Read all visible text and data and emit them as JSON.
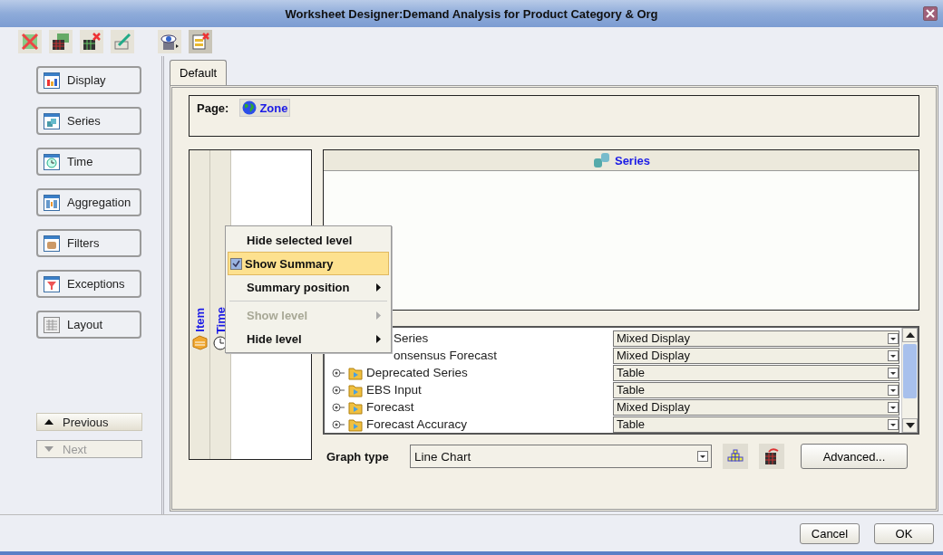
{
  "window": {
    "title": "Worksheet Designer:Demand Analysis for Product Category & Org"
  },
  "toolbar": [
    {
      "kind": "delete",
      "pressed": false
    },
    {
      "kind": "grid",
      "pressed": false
    },
    {
      "kind": "grid-delete",
      "pressed": false
    },
    {
      "kind": "edit",
      "pressed": false
    },
    {
      "kind": "view",
      "pressed": false
    },
    {
      "kind": "close-list",
      "pressed": true
    }
  ],
  "nav_buttons": [
    {
      "label": "Display",
      "kind": "display"
    },
    {
      "label": "Series",
      "kind": "series"
    },
    {
      "label": "Time",
      "kind": "time"
    },
    {
      "label": "Aggregation",
      "kind": "aggregation"
    },
    {
      "label": "Filters",
      "kind": "filters"
    },
    {
      "label": "Exceptions",
      "kind": "exceptions"
    },
    {
      "label": "Layout",
      "kind": "layout"
    }
  ],
  "step_buttons": [
    {
      "label": "Previous",
      "kind": "up",
      "disabled": false
    },
    {
      "label": "Next",
      "kind": "down",
      "disabled": true
    }
  ],
  "tabs": [
    {
      "label": "Default",
      "selected": true
    }
  ],
  "page": {
    "label": "Page:",
    "dimension": "Zone"
  },
  "axes": [
    {
      "label": "Item",
      "kind": "item"
    },
    {
      "label": "Time",
      "kind": "time"
    }
  ],
  "series_panel": {
    "title": "Series"
  },
  "context_menu": [
    {
      "kind": "item",
      "label": "Hide selected level",
      "checked": false,
      "selected": false,
      "disabled": false,
      "submenu": false
    },
    {
      "kind": "item",
      "label": "Show Summary",
      "checked": true,
      "selected": true,
      "disabled": false,
      "submenu": false
    },
    {
      "kind": "item",
      "label": "Summary position",
      "checked": false,
      "selected": false,
      "disabled": false,
      "submenu": true
    },
    {
      "kind": "separator"
    },
    {
      "kind": "item",
      "label": "Show level",
      "checked": false,
      "selected": false,
      "disabled": true,
      "submenu": true
    },
    {
      "kind": "item",
      "label": "Hide level",
      "checked": false,
      "selected": false,
      "disabled": false,
      "submenu": true
    }
  ],
  "series_table": [
    {
      "name": "Series",
      "display": "Mixed Display",
      "icon": false
    },
    {
      "name": "onsensus Forecast",
      "display": "Mixed Display",
      "icon": false
    },
    {
      "name": "Deprecated Series",
      "display": "Table",
      "icon": true
    },
    {
      "name": "EBS Input",
      "display": "Table",
      "icon": true
    },
    {
      "name": "Forecast",
      "display": "Mixed Display",
      "icon": true
    },
    {
      "name": "Forecast Accuracy",
      "display": "Table",
      "icon": true
    }
  ],
  "graph": {
    "label": "Graph type",
    "value": "Line Chart"
  },
  "advanced_button": "Advanced...",
  "footer_buttons": [
    "Cancel",
    "OK"
  ]
}
